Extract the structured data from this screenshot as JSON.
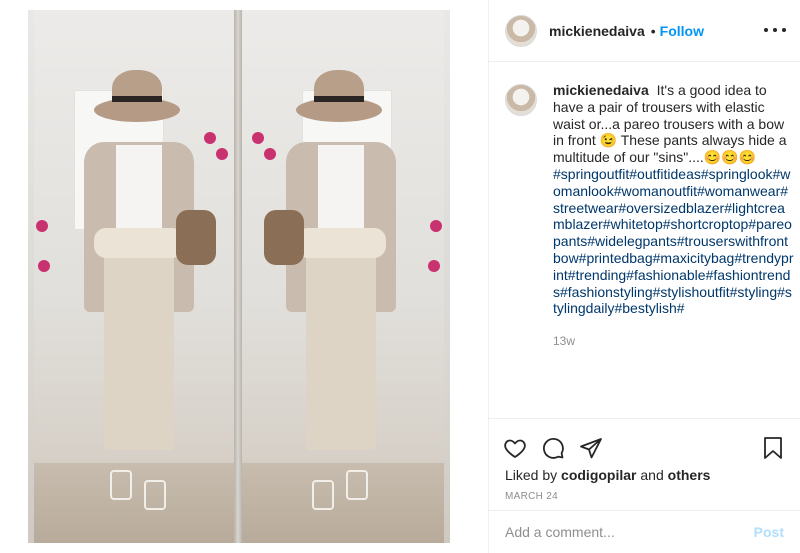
{
  "post": {
    "username": "mickienedaiva",
    "separator": "•",
    "follow_label": "Follow",
    "more_icon": "more-options-icon"
  },
  "caption": {
    "username": "mickienedaiva",
    "text": "It's a good idea to have a pair of trousers with elastic waist or...a pareo trousers with a bow in front 😉 These pants always hide a multitude of our \"sins\"....😊😊😊",
    "hashtags": "#springoutfit#outfitideas#springlook#womanlook#womanoutfit#womanwear#streetwear#oversizedblazer#lightcreamblazer#whitetop#shortcroptop#pareopants#widelegpants#trouserswithfrontbow#printedbag#maxicitybag#trendyprint#trending#fashionable#fashiontrends#fashionstyling#stylishoutfit#styling#stylingdaily#bestylish#",
    "age": "13w"
  },
  "actions": {
    "like_icon": "heart-icon",
    "comment_icon": "comment-icon",
    "share_icon": "share-icon",
    "save_icon": "bookmark-icon"
  },
  "likes": {
    "prefix": "Liked by",
    "user": "codigopilar",
    "conjunction": "and",
    "others": "others"
  },
  "date": "MARCH 24",
  "comment": {
    "placeholder": "Add a comment...",
    "post_label": "Post"
  },
  "colors": {
    "link_blue": "#0095f6",
    "hashtag_blue": "#00376b",
    "post_disabled": "#b2dffc",
    "muted_text": "#8e8e8e"
  }
}
